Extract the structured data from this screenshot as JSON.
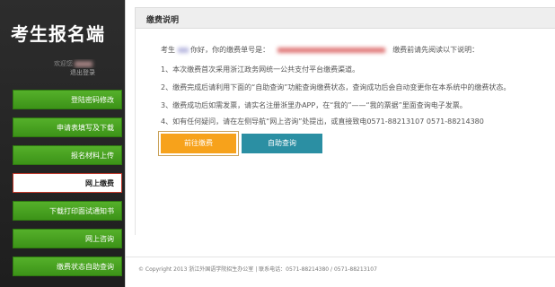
{
  "sidebar": {
    "logo": "考生报名端",
    "welcome_prefix": "欢迎您",
    "logout": "退出登录",
    "items": [
      {
        "label": "登陆密码修改"
      },
      {
        "label": "申请表填写及下载"
      },
      {
        "label": "报名材料上传"
      },
      {
        "label": "网上缴费"
      },
      {
        "label": "下载打印面试通知书"
      },
      {
        "label": "网上咨询"
      },
      {
        "label": "缴费状态自助查询"
      }
    ]
  },
  "panel": {
    "title": "缴费说明",
    "greeting_prefix": "考生",
    "greeting_middle": "你好，你的缴费单号是：",
    "greeting_suffix": "缴费前请先阅读以下说明：",
    "lines": [
      "1、本次缴费首次采用浙江政务网统一公共支付平台缴费渠道。",
      "2、缴费完成后请利用下面的“自助查询”功能查询缴费状态，查询成功后会自动变更你在本系统中的缴费状态。",
      "3、缴费成功后如需发票，请实名注册浙里办APP，在“我的”——“我的票据”里面查询电子发票。",
      "4、如有任何疑问，请在左侧导航“网上咨询”处提出，或直接致电0571-88213107 0571-88214380"
    ],
    "pay_button": "前往缴费",
    "query_button": "自助查询"
  },
  "footer": {
    "text": "© Copyright 2013 浙江外国语学院招生办公室 | 联系电话：0571-88214380 / 0571-88213107"
  },
  "colors": {
    "menu_green": "#4aa322",
    "pay_orange": "#f7a21b",
    "query_teal": "#2b8fa3"
  }
}
